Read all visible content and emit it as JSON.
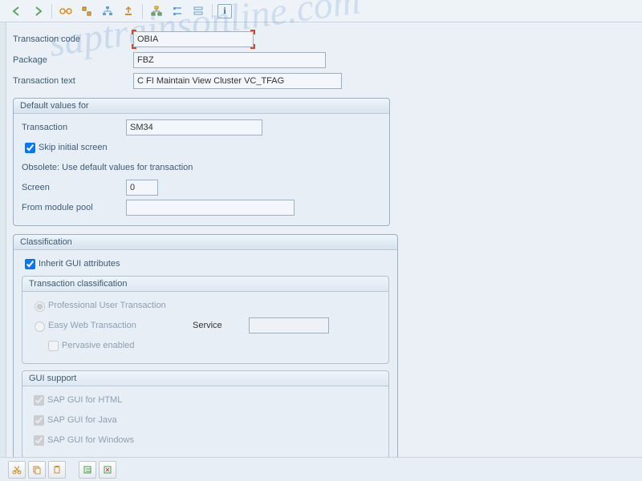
{
  "toolbar": {
    "back": "⇦",
    "forward": "⇨",
    "glasses": "👓",
    "tree1": "☰",
    "tree2": "☰",
    "export": "⇪",
    "hier1": "品",
    "hier2": "≣",
    "hier3": "▦",
    "info": "i"
  },
  "fields": {
    "tcode_label": "Transaction code",
    "tcode_value": "OBIA",
    "package_label": "Package",
    "package_value": "FBZ",
    "ttext_label": "Transaction text",
    "ttext_value": "C FI Maintain View Cluster VC_TFAG"
  },
  "defaults": {
    "title": "Default values for",
    "transaction_label": "Transaction",
    "transaction_value": "SM34",
    "skip_label": "Skip initial screen",
    "obsolete": "Obsolete: Use default values for transaction",
    "screen_label": "Screen",
    "screen_value": "0",
    "pool_label": "From module pool",
    "pool_value": ""
  },
  "classification": {
    "title": "Classification",
    "inherit": "Inherit GUI attributes",
    "tc_title": "Transaction classification",
    "prof": "Professional User Transaction",
    "easy": "Easy Web Transaction",
    "service_label": "Service",
    "service_value": "",
    "pervasive": "Pervasive enabled",
    "gui_title": "GUI support",
    "gui_html": "SAP GUI for HTML",
    "gui_java": "SAP GUI for Java",
    "gui_win": "SAP GUI for Windows"
  },
  "watermark": "saptrainsonline.com"
}
